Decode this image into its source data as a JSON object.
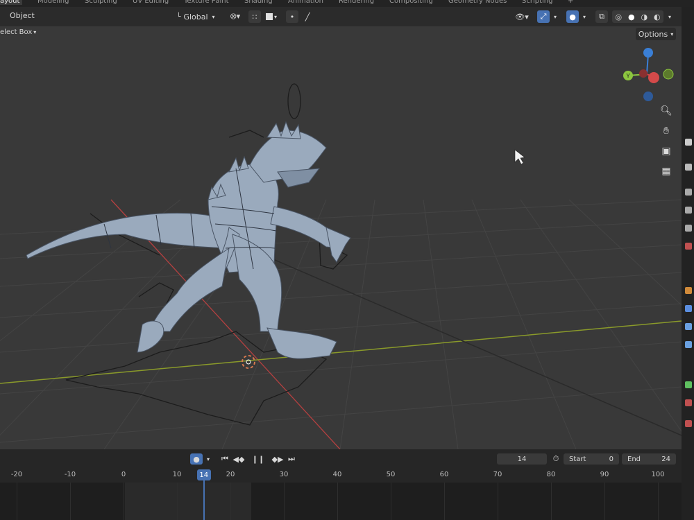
{
  "workspaces": [
    {
      "label": "ayout",
      "active": true
    },
    {
      "label": "Modeling"
    },
    {
      "label": "Sculpting"
    },
    {
      "label": "UV Editing"
    },
    {
      "label": "Texture Paint"
    },
    {
      "label": "Shading"
    },
    {
      "label": "Animation"
    },
    {
      "label": "Rendering"
    },
    {
      "label": "Compositing"
    },
    {
      "label": "Geometry Nodes"
    },
    {
      "label": "Scripting"
    },
    {
      "label": "+"
    }
  ],
  "header": {
    "mode_label": "Object",
    "transform_orientation": "Global",
    "options_label": "Options",
    "select_mode": "elect Box"
  },
  "timeline": {
    "current_frame": "14",
    "start_label": "Start",
    "start_value": "0",
    "end_label": "End",
    "end_value": "24",
    "playhead_label": "14",
    "ruler_ticks": [
      {
        "label": "-20",
        "frame": -20
      },
      {
        "label": "-10",
        "frame": -10
      },
      {
        "label": "0",
        "frame": 0
      },
      {
        "label": "10",
        "frame": 10
      },
      {
        "label": "20",
        "frame": 20
      },
      {
        "label": "30",
        "frame": 30
      },
      {
        "label": "40",
        "frame": 40
      },
      {
        "label": "50",
        "frame": 50
      },
      {
        "label": "60",
        "frame": 60
      },
      {
        "label": "70",
        "frame": 70
      },
      {
        "label": "80",
        "frame": 80
      },
      {
        "label": "90",
        "frame": 90
      },
      {
        "label": "100",
        "frame": 100
      }
    ]
  },
  "gizmo": {
    "x_color": "#d44a4a",
    "y_color": "#8cc63f",
    "z_color": "#3a7fd6",
    "y_label": "Y"
  },
  "nav_icons": [
    "zoom-icon",
    "pan-hand-icon",
    "camera-icon",
    "grid-ortho-icon"
  ],
  "colors": {
    "viewport_bg": "#393939",
    "x_axis_line": "#b54040",
    "y_axis_line": "#8a9a2a",
    "mesh": "#9aaabd",
    "accent": "#4772b3"
  }
}
